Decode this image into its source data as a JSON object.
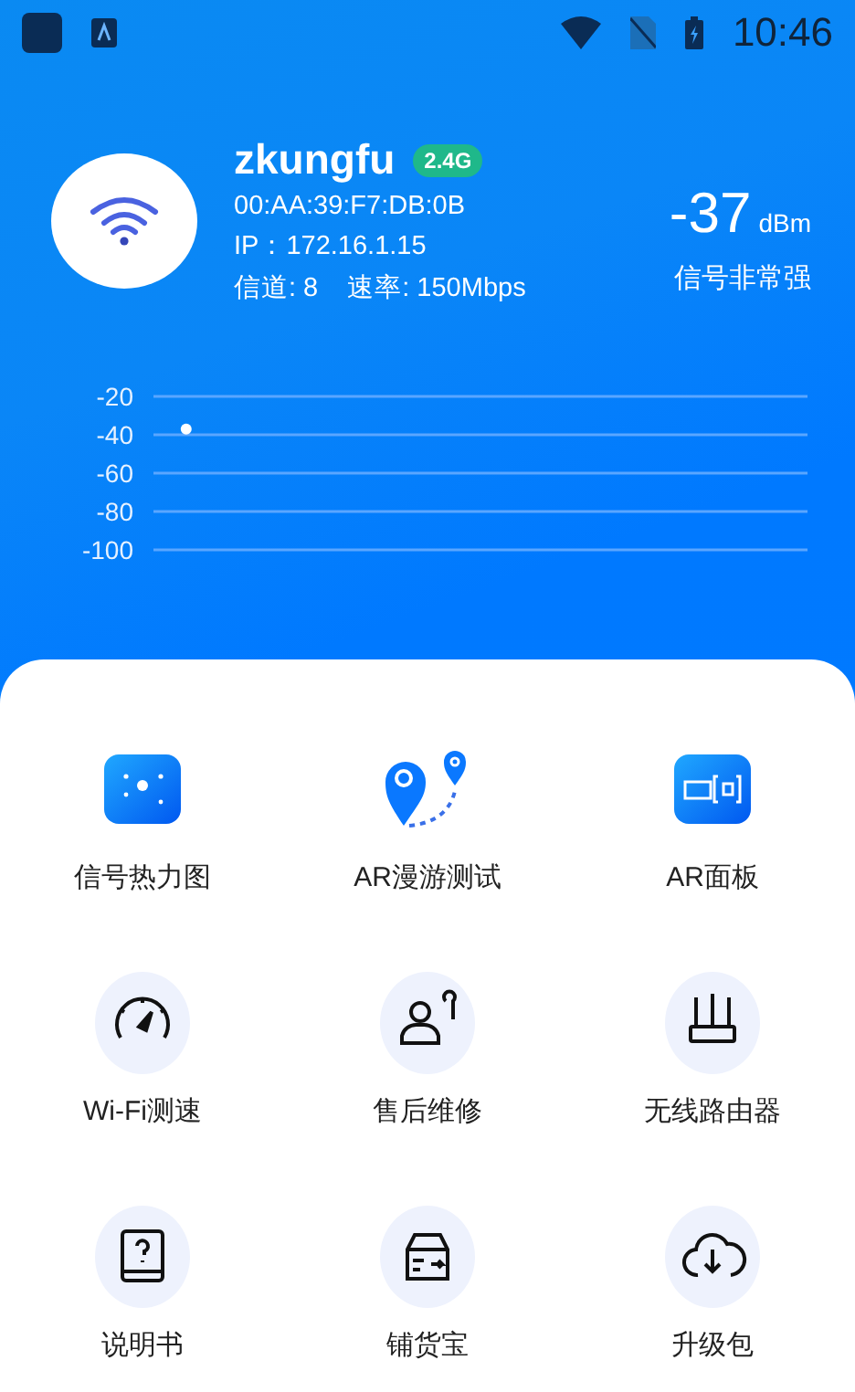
{
  "status_bar": {
    "time": "10:46"
  },
  "network": {
    "name": "zkungfu",
    "band": "2.4G",
    "mac": "00:AA:39:F7:DB:0B",
    "ip": "IP：172.16.1.15",
    "channel": "信道: 8",
    "rate": "速率: 150Mbps",
    "signal": "-37",
    "unit": "dBm",
    "quality": "信号非常强"
  },
  "chart_data": {
    "type": "line",
    "grid": true,
    "categories": [
      null,
      null,
      null,
      null,
      null,
      null,
      null,
      null,
      null,
      null
    ],
    "ylim": [
      -100,
      -20
    ],
    "yticks": [
      -20,
      -40,
      -60,
      -80,
      -100
    ],
    "series": [
      {
        "marker": true,
        "values": [
          -37,
          null,
          null,
          null,
          null,
          null,
          null,
          null,
          null,
          null
        ]
      }
    ]
  },
  "tools": [
    {
      "label": "信号热力图"
    },
    {
      "label": "AR漫游测试"
    },
    {
      "label": "AR面板"
    },
    {
      "label": "Wi-Fi测速"
    },
    {
      "label": "售后维修"
    },
    {
      "label": "无线路由器"
    },
    {
      "label": "说明书"
    },
    {
      "label": "铺货宝"
    },
    {
      "label": "升级包"
    }
  ]
}
